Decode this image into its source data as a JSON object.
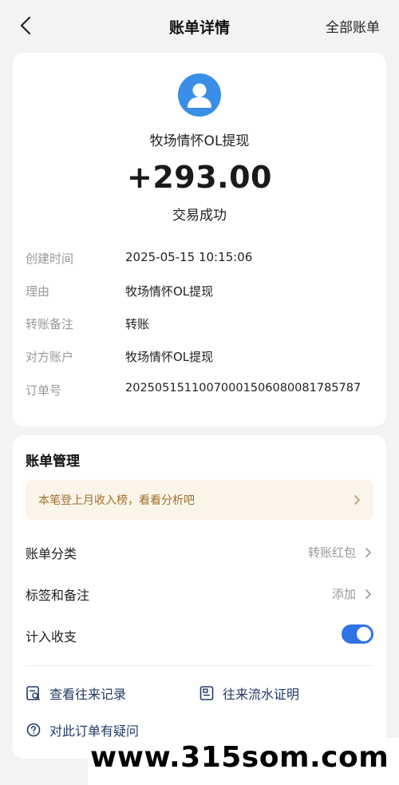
{
  "header": {
    "title": "账单详情",
    "right_link": "全部账单"
  },
  "transaction": {
    "counterparty": "牧场情怀OL提现",
    "amount": "+293.00",
    "status": "交易成功",
    "details": [
      {
        "label": "创建时间",
        "value": "2025-05-15 10:15:06"
      },
      {
        "label": "理由",
        "value": "牧场情怀OL提现"
      },
      {
        "label": "转账备注",
        "value": "转账"
      },
      {
        "label": "对方账户",
        "value": "牧场情怀OL提现"
      },
      {
        "label": "订单号",
        "value": "2025051511007000150608008178578​7"
      }
    ]
  },
  "management": {
    "title": "账单管理",
    "banner_text": "本笔登上月收入榜，看看分析吧",
    "category_label": "账单分类",
    "category_value": "转账红包",
    "tags_label": "标签和备注",
    "tags_value": "添加",
    "include_label": "计入收支",
    "include_enabled": true,
    "link_history": "查看往来记录",
    "link_proof": "往来流水证明",
    "link_question": "对此订单有疑问"
  },
  "watermark": {
    "text": "www.315som.com"
  },
  "colors": {
    "accent": "#2f73e6",
    "avatar": "#3a8ee6",
    "banner_bg": "#fbf4e9",
    "banner_text": "#a0702a"
  }
}
